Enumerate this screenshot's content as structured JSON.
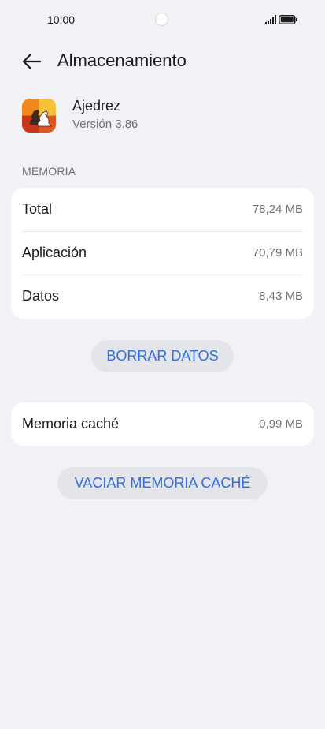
{
  "status_bar": {
    "time": "10:00",
    "icons": [
      "camera-cutout",
      "signal-icon",
      "battery-icon"
    ]
  },
  "header": {
    "title": "Almacenamiento",
    "back_icon": "arrow-left-icon"
  },
  "app": {
    "name": "Ajedrez",
    "version": "Versión 3.86",
    "icon": "chess-app-icon"
  },
  "memory_section": {
    "label": "MEMORIA",
    "rows": [
      {
        "label": "Total",
        "value": "78,24 MB"
      },
      {
        "label": "Aplicación",
        "value": "70,79 MB"
      },
      {
        "label": "Datos",
        "value": "8,43 MB"
      }
    ]
  },
  "clear_data_button": {
    "label": "BORRAR DATOS"
  },
  "cache": {
    "label": "Memoria caché",
    "value": "0,99 MB"
  },
  "clear_cache_button": {
    "label": "VACIAR MEMORIA CACHÉ"
  },
  "colors": {
    "background": "#f1f2f6",
    "card": "#ffffff",
    "accent": "#2f6ee0",
    "button_bg": "#e4e5ea",
    "secondary_text": "#6f7176"
  }
}
